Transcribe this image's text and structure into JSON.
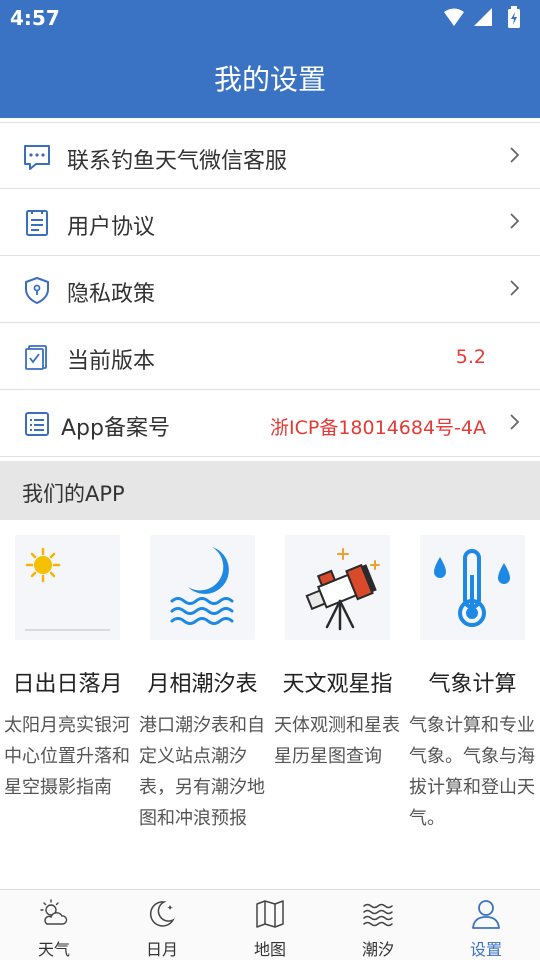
{
  "status_bar": {
    "time": "4:57"
  },
  "header": {
    "title": "我的设置"
  },
  "menu": [
    {
      "label": "联系钓鱼天气微信客服",
      "icon": "chat-icon",
      "value": "",
      "has_arrow": true
    },
    {
      "label": "用户协议",
      "icon": "document-icon",
      "value": "",
      "has_arrow": true
    },
    {
      "label": "隐私政策",
      "icon": "shield-icon",
      "value": "",
      "has_arrow": true
    },
    {
      "label": "当前版本",
      "icon": "version-icon",
      "value": "5.2",
      "has_arrow": false
    },
    {
      "label": "App备案号",
      "icon": "record-icon",
      "value": "浙ICP备18014684号-4A",
      "has_arrow": true
    }
  ],
  "section": {
    "title": "我们的APP"
  },
  "apps": [
    {
      "name": "日出日落月",
      "desc": "太阳月亮实银河中心位置升落和星空摄影指南",
      "icon": "sun-moon-icon"
    },
    {
      "name": "月相潮汐表",
      "desc": "港口潮汐表和自定义站点潮汐表，另有潮汐地图和冲浪预报",
      "icon": "moon-tide-icon"
    },
    {
      "name": "天文观星指",
      "desc": "天体观测和星表星历星图查询",
      "icon": "telescope-icon"
    },
    {
      "name": "气象计算",
      "desc": "气象计算和专业气象。气象与海拔计算和登山天气。",
      "icon": "thermometer-icon"
    }
  ],
  "tabs": [
    {
      "label": "天气",
      "icon": "weather-icon",
      "active": false
    },
    {
      "label": "日月",
      "icon": "moon-icon",
      "active": false
    },
    {
      "label": "地图",
      "icon": "map-icon",
      "active": false
    },
    {
      "label": "潮汐",
      "icon": "waves-icon",
      "active": false
    },
    {
      "label": "设置",
      "icon": "person-icon",
      "active": true
    }
  ],
  "colors": {
    "primary": "#3b73c4",
    "accent_red": "#e53935",
    "section_bg": "#e6e6e6",
    "icon_blue": "#3a6fc0"
  }
}
